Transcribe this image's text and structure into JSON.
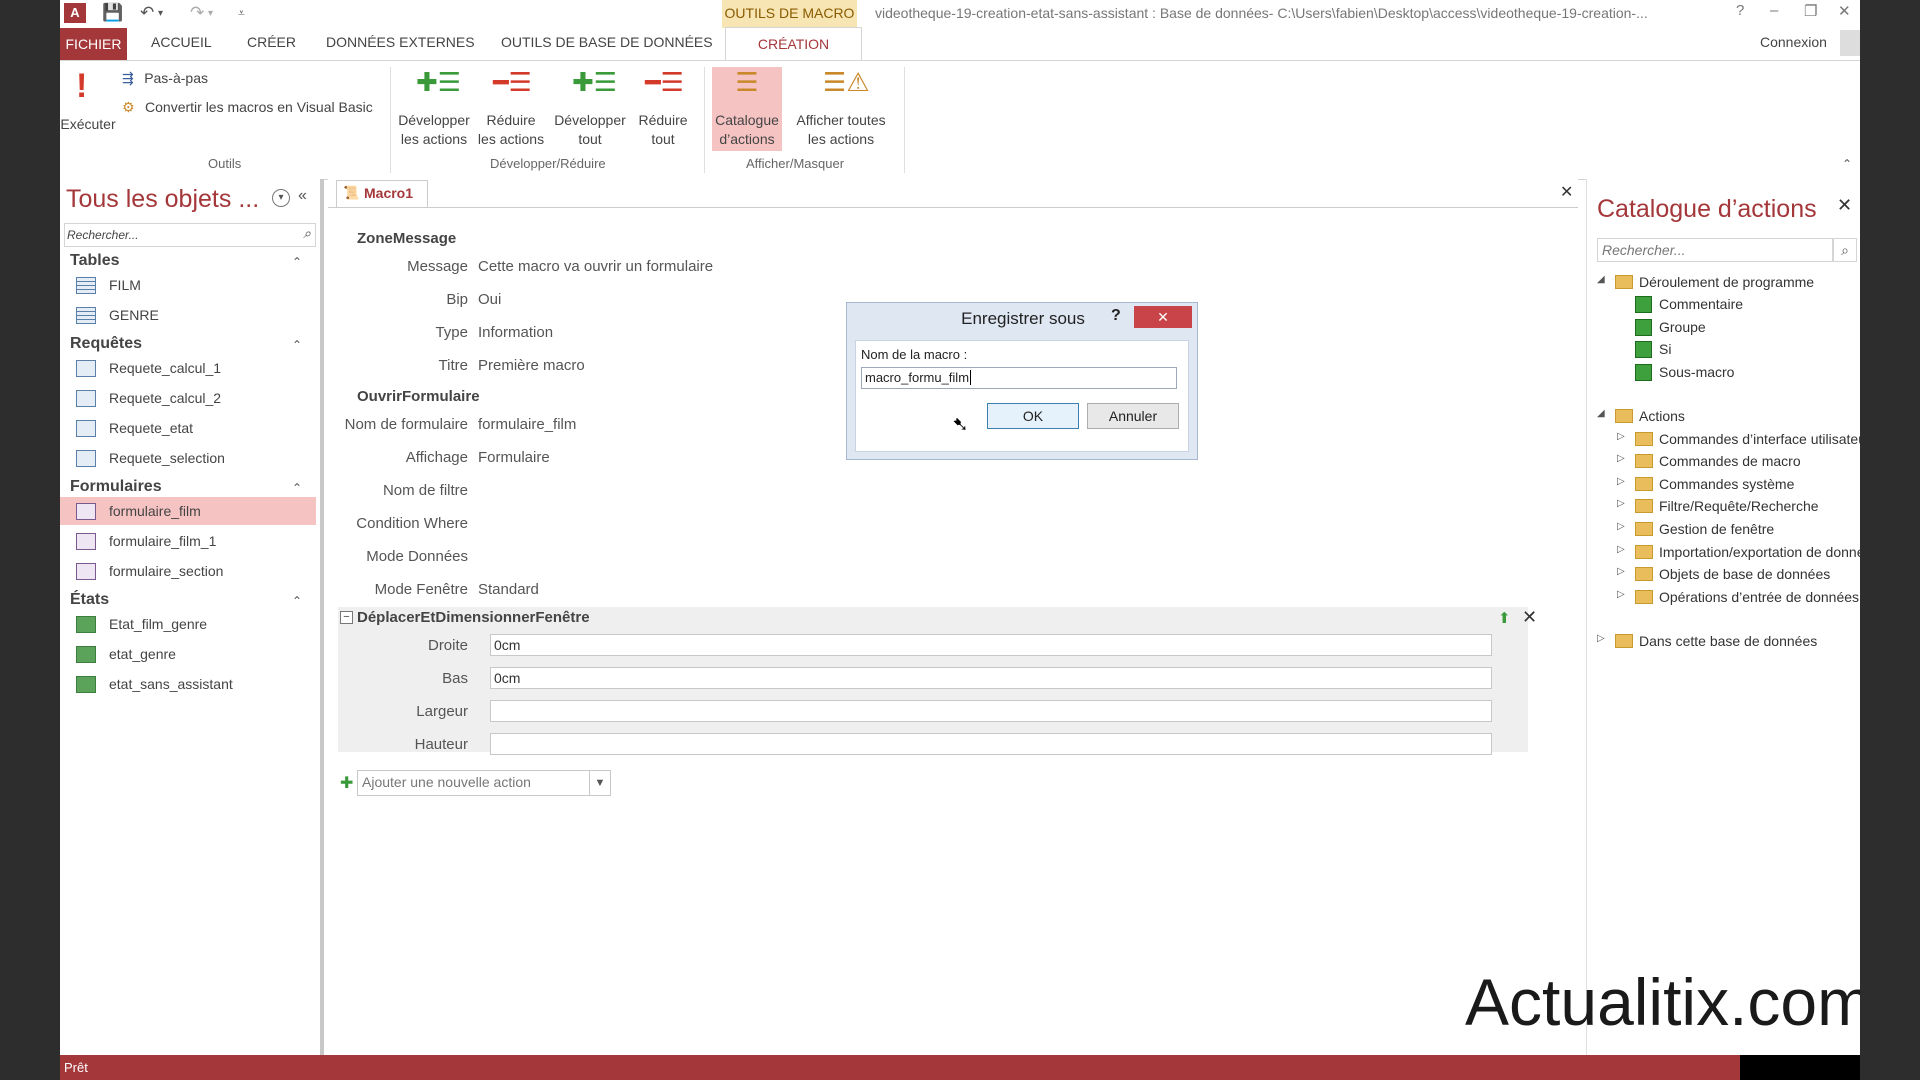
{
  "colors": {
    "accent": "#a4373a",
    "context_tab": "#f7e6b3",
    "active_button": "#f6c3c3"
  },
  "titlebar": {
    "context_tab": "OUTILS DE MACRO",
    "title": "videotheque-19-creation-etat-sans-assistant : Base de données- C:\\Users\\fabien\\Desktop\\access\\videotheque-19-creation-...",
    "help": "?",
    "minimize": "–",
    "restore": "❐",
    "close": "✕"
  },
  "tabs": {
    "file": "FICHIER",
    "home": "ACCUEIL",
    "create": "CRÉER",
    "external": "DONNÉES EXTERNES",
    "dbtools": "OUTILS DE BASE DE DONNÉES",
    "design": "CRÉATION",
    "login": "Connexion"
  },
  "ribbon": {
    "run": "Exécuter",
    "single_step": "Pas-à-pas",
    "convert": "Convertir les macros en Visual Basic",
    "group_tools": "Outils",
    "expand_actions": [
      "Développer",
      "les actions"
    ],
    "collapse_actions": [
      "Réduire",
      "les actions"
    ],
    "expand_all": [
      "Développer",
      "tout"
    ],
    "collapse_all": [
      "Réduire",
      "tout"
    ],
    "group_expand": "Développer/Réduire",
    "action_catalog": [
      "Catalogue",
      "d’actions"
    ],
    "show_all": [
      "Afficher toutes",
      "les actions"
    ],
    "group_show": "Afficher/Masquer"
  },
  "nav": {
    "title": "Tous les objets ...",
    "search_placeholder": "Rechercher...",
    "sections": {
      "tables": {
        "label": "Tables",
        "items": [
          "FILM",
          "GENRE"
        ]
      },
      "queries": {
        "label": "Requêtes",
        "items": [
          "Requete_calcul_1",
          "Requete_calcul_2",
          "Requete_etat",
          "Requete_selection"
        ]
      },
      "forms": {
        "label": "Formulaires",
        "items": [
          "formulaire_film",
          "formulaire_film_1",
          "formulaire_section"
        ]
      },
      "reports": {
        "label": "États",
        "items": [
          "Etat_film_genre",
          "etat_genre",
          "etat_sans_assistant"
        ]
      }
    }
  },
  "doc": {
    "tab_label": "Macro1",
    "close": "✕",
    "action1": {
      "name": "ZoneMessage",
      "args": [
        {
          "label": "Message",
          "value": "Cette macro va ouvrir un formulaire"
        },
        {
          "label": "Bip",
          "value": "Oui"
        },
        {
          "label": "Type",
          "value": "Information"
        },
        {
          "label": "Titre",
          "value": "Première macro"
        }
      ]
    },
    "action2": {
      "name": "OuvrirFormulaire",
      "args": [
        {
          "label": "Nom de formulaire",
          "value": "formulaire_film"
        },
        {
          "label": "Affichage",
          "value": "Formulaire"
        },
        {
          "label": "Nom de filtre",
          "value": ""
        },
        {
          "label": "Condition Where",
          "value": ""
        },
        {
          "label": "Mode Données",
          "value": ""
        },
        {
          "label": "Mode Fenêtre",
          "value": "Standard"
        }
      ]
    },
    "action3": {
      "name": "DéplacerEtDimensionnerFenêtre",
      "args": [
        {
          "label": "Droite",
          "value": "0cm"
        },
        {
          "label": "Bas",
          "value": "0cm"
        },
        {
          "label": "Largeur",
          "value": ""
        },
        {
          "label": "Hauteur",
          "value": ""
        }
      ]
    },
    "add_action": "Ajouter une nouvelle action"
  },
  "dialog": {
    "title": "Enregistrer sous",
    "help": "?",
    "close": "✕",
    "label": "Nom de la macro :",
    "value": "macro_formu_film",
    "ok": "OK",
    "cancel": "Annuler"
  },
  "catalog": {
    "title": "Catalogue d’actions",
    "close": "✕",
    "search_placeholder": "Rechercher...",
    "flow": {
      "label": "Déroulement de programme",
      "items": [
        "Commentaire",
        "Groupe",
        "Si",
        "Sous-macro"
      ]
    },
    "actions": {
      "label": "Actions",
      "items": [
        "Commandes d’interface utilisateur",
        "Commandes de macro",
        "Commandes système",
        "Filtre/Requête/Recherche",
        "Gestion de fenêtre",
        "Importation/exportation de données",
        "Objets de base de données",
        "Opérations d’entrée de données"
      ]
    },
    "in_db": "Dans cette base de données"
  },
  "watermark": "Actualitix.com",
  "status": "Prêt"
}
